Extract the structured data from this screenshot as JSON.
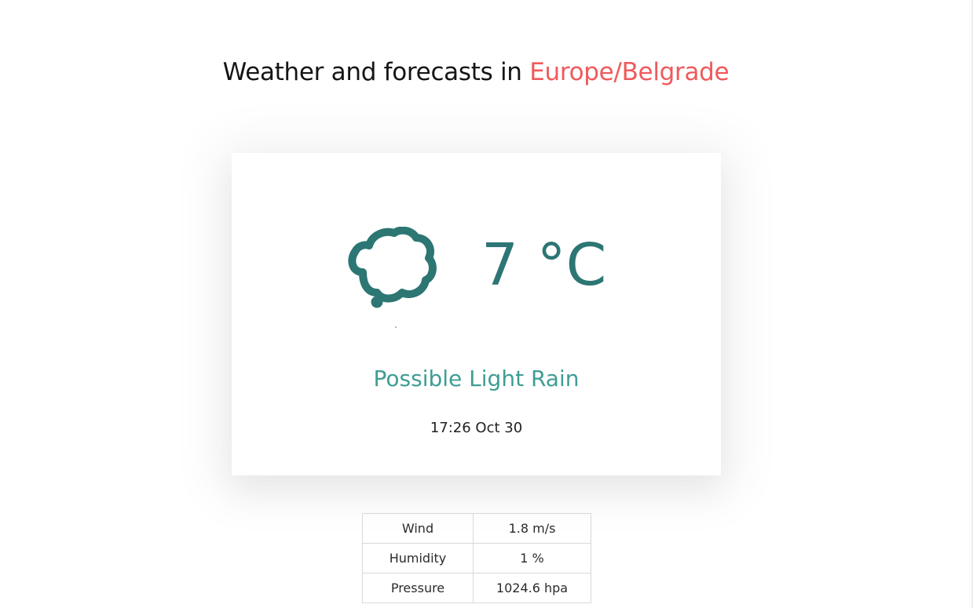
{
  "header": {
    "prefix": "Weather and forecasts in",
    "city": "Europe/Belgrade"
  },
  "current": {
    "icon": "cloud-rain-icon",
    "temperature": "7 °C",
    "summary": "Possible Light Rain",
    "time": "17:26 Oct 30"
  },
  "details": [
    {
      "label": "Wind",
      "value": "1.8 m/s"
    },
    {
      "label": "Humidity",
      "value": "1 %"
    },
    {
      "label": "Pressure",
      "value": "1024.6 hpa"
    }
  ],
  "colors": {
    "accent": "#ef5a5c",
    "icon": "#2c7674",
    "summary": "#3f9d95"
  }
}
